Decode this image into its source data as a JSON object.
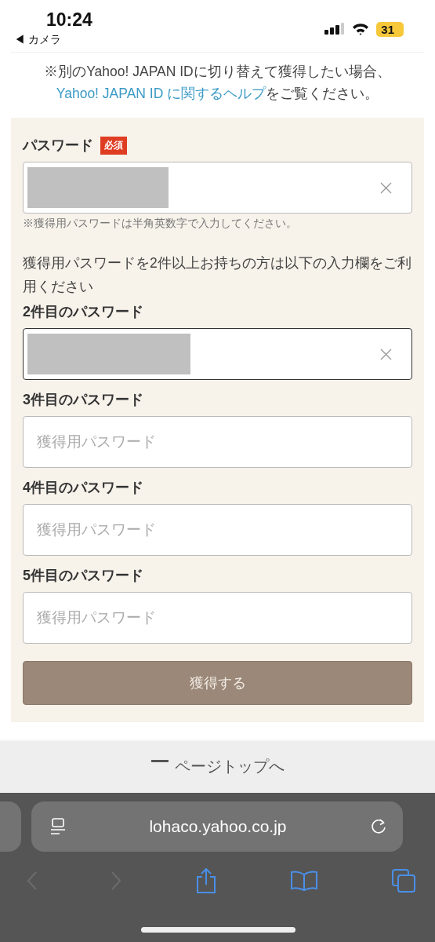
{
  "status_bar": {
    "time": "10:24",
    "back_label": "◀ カメラ",
    "battery": "31"
  },
  "notice": {
    "text": "※別のYahoo! JAPAN IDに切り替えて獲得したい場合、",
    "link": "Yahoo! JAPAN ID に関するヘルプ",
    "text_after": "をご覧ください。"
  },
  "form": {
    "items": [
      {
        "kind": "field",
        "label": "パスワード",
        "badge": "必須",
        "filled": true,
        "focused": false
      },
      {
        "kind": "hint",
        "text": "※獲得用パスワードは半角英数字で入力してください。"
      },
      {
        "kind": "intro",
        "text": "獲得用パスワードを2件以上お持ちの方は以下の入力欄をご利用ください"
      },
      {
        "kind": "field",
        "label": "2件目のパスワード",
        "filled": true,
        "focused": true
      },
      {
        "kind": "field",
        "label": "3件目のパスワード",
        "filled": false,
        "focused": false,
        "placeholder": "獲得用パスワード"
      },
      {
        "kind": "field",
        "label": "4件目のパスワード",
        "filled": false,
        "focused": false,
        "placeholder": "獲得用パスワード"
      },
      {
        "kind": "field",
        "label": "5件目のパスワード",
        "filled": false,
        "focused": false,
        "placeholder": "獲得用パスワード"
      }
    ],
    "submit": "獲得する"
  },
  "page_top": "ページトップへ",
  "browser": {
    "url": "lohaco.yahoo.co.jp"
  }
}
